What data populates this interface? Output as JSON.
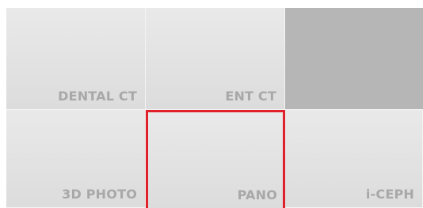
{
  "modes": [
    {
      "label": "DENTAL CT"
    },
    {
      "label": "ENT CT"
    },
    {
      "label": "3D PHOTO"
    },
    {
      "label": "PANO",
      "selected": true
    },
    {
      "label": "i-CEPH"
    }
  ],
  "colors": {
    "selection_border": "#e0202a",
    "tile_background": "#e4e4e4",
    "empty_tile": "#b6b6b6",
    "label_text": "#a8a8a8"
  }
}
